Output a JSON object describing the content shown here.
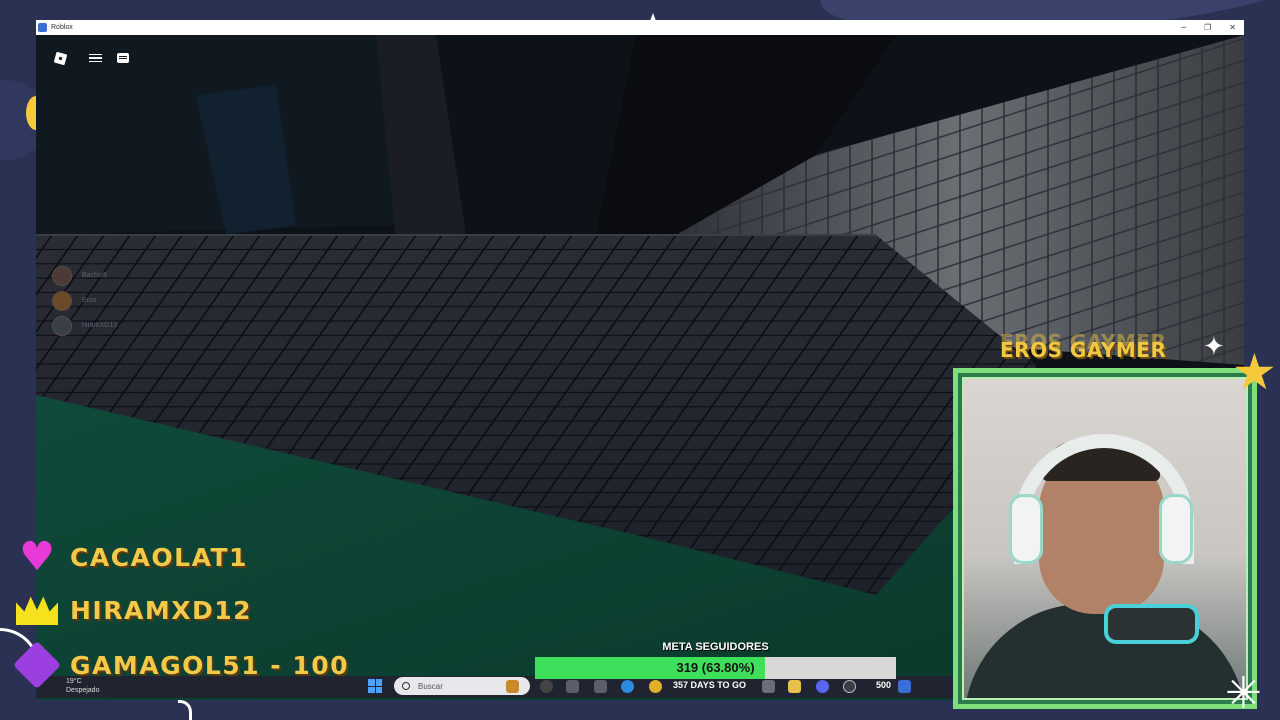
{
  "window": {
    "title": "Roblox",
    "controls": {
      "minimize": "─",
      "maximize": "❐",
      "close": "✕"
    }
  },
  "roblox_hud": {
    "players": [
      {
        "name": "Bachis9"
      },
      {
        "name": "Eros"
      },
      {
        "name": "hiramXD13"
      }
    ]
  },
  "stream": {
    "webcam_title": "EROS GAYMER",
    "supporters": [
      {
        "name": "CACAOLAT1",
        "icon": "heart-icon",
        "color": "#e83ad8"
      },
      {
        "name": "HIRAMXD12",
        "icon": "crown-icon",
        "color": "#f6e11e"
      },
      {
        "name": "GAMAGOL51 - 100",
        "icon": "diamond-icon",
        "color": "#9b3fe0"
      }
    ],
    "follower_goal": {
      "label": "META SEGUIDORES",
      "value_text": "319 (63.80%)",
      "progress": 0.638
    }
  },
  "taskbar": {
    "weather_temp": "19°C",
    "weather_desc": "Despejado",
    "search_placeholder": "Buscar",
    "days_to_go": "357 DAYS TO GO",
    "counter": "500"
  },
  "colors": {
    "accent_gold": "#f3c94a",
    "frame_green": "#7ede7a",
    "goal_green": "#3ee05b"
  }
}
